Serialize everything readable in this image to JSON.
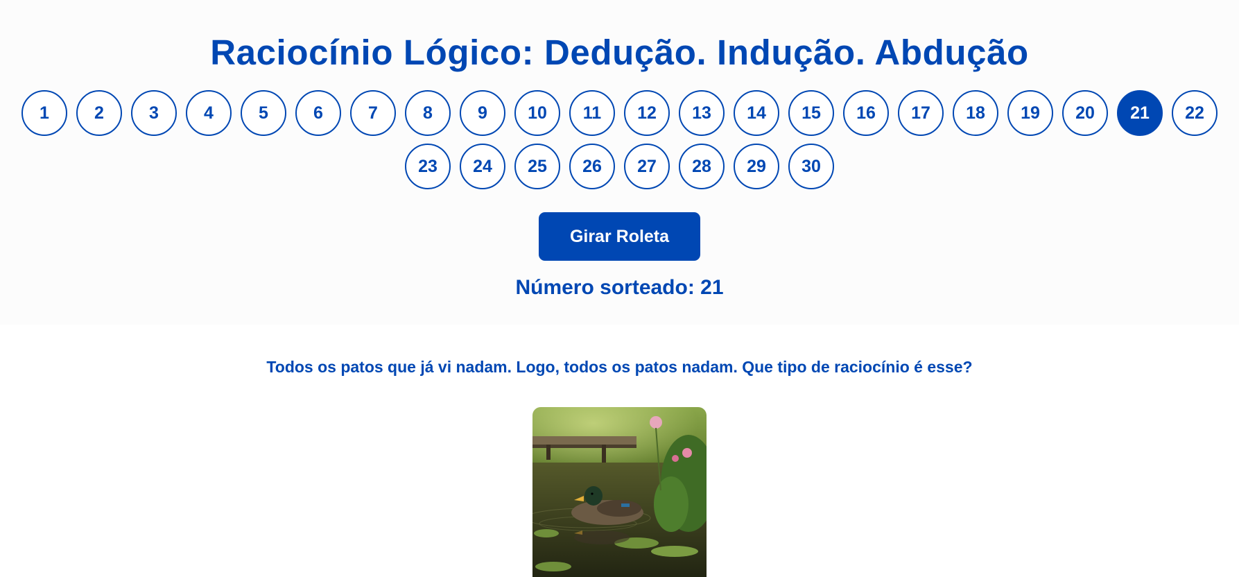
{
  "title": "Raciocínio Lógico: Dedução. Indução. Abdução",
  "numbers": [
    "1",
    "2",
    "3",
    "4",
    "5",
    "6",
    "7",
    "8",
    "9",
    "10",
    "11",
    "12",
    "13",
    "14",
    "15",
    "16",
    "17",
    "18",
    "19",
    "20",
    "21",
    "22",
    "23",
    "24",
    "25",
    "26",
    "27",
    "28",
    "29",
    "30"
  ],
  "selected_number": "21",
  "spin_button_label": "Girar Roleta",
  "result": {
    "label": "Número sorteado:",
    "value": "21"
  },
  "question": "Todos os patos que já vi nadam. Logo, todos os patos nadam. Que tipo de raciocínio é esse?",
  "image": {
    "alt": "pato nadando em um lago"
  },
  "colors": {
    "accent": "#0047b3",
    "panel": "#fcfcfc"
  }
}
